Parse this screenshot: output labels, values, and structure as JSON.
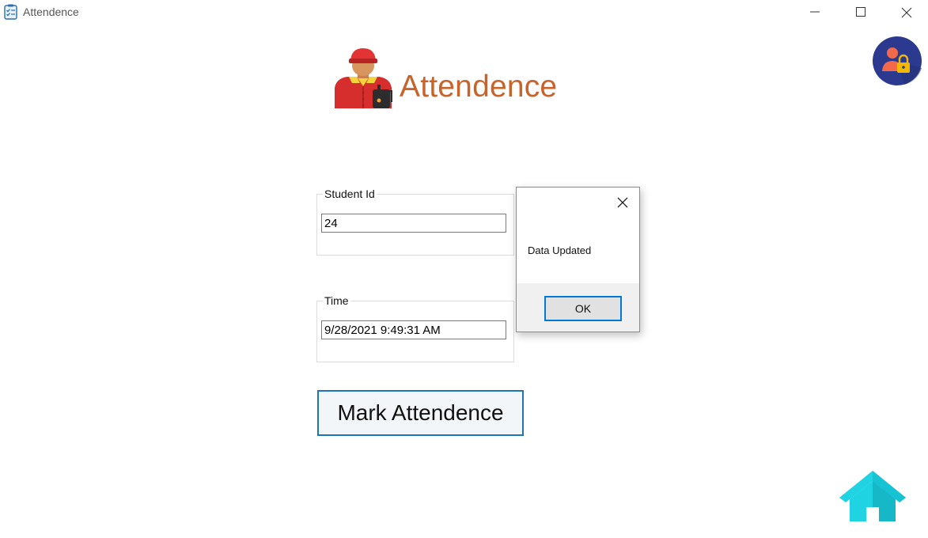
{
  "window": {
    "title": "Attendence",
    "icon": "attendance-checklist-icon"
  },
  "header": {
    "title": "Attendence",
    "title_color": "#c8642a",
    "illustration": "worker-avatar-icon"
  },
  "admin_button": {
    "icon": "user-lock-icon",
    "color": "#2b3a8f"
  },
  "form": {
    "student_id": {
      "label": "Student Id",
      "value": "24"
    },
    "time": {
      "label": "Time",
      "value": "9/28/2021 9:49:31 AM"
    },
    "submit_label": "Mark Attendence"
  },
  "home_button": {
    "icon": "home-icon",
    "color": "#1fd3e3"
  },
  "dialog": {
    "message": "Data Updated",
    "ok_label": "OK"
  },
  "colors": {
    "accent_blue": "#1f73b7",
    "dialog_focus": "#0078d7"
  }
}
